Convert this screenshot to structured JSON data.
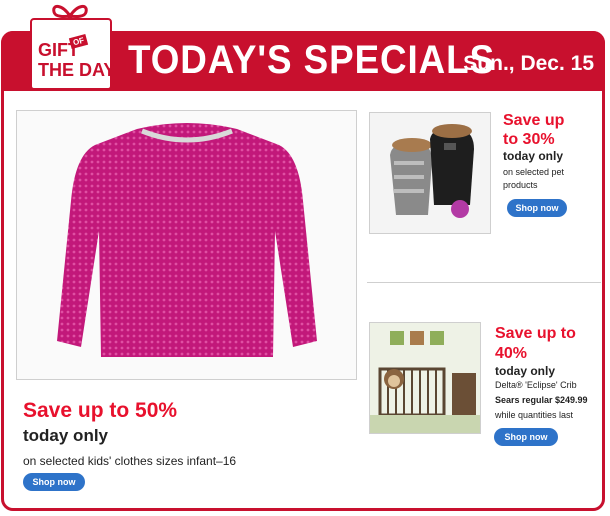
{
  "header": {
    "badge_line1": "GIFT",
    "badge_of": "OF",
    "badge_line2": "THE DAY",
    "title": "TODAY'S SPECIALS",
    "date": "Sun., Dec. 15"
  },
  "main_deal": {
    "image_alt": "pink knit sweater",
    "save_text": "Save up to 50%",
    "today_text": "today only",
    "description": "on selected kids' clothes sizes infant–16",
    "button_label": "Shop now"
  },
  "pet_deal": {
    "image_alt": "pet coats",
    "save_line1": "Save up",
    "save_line2": "to 30%",
    "today_text": "today only",
    "desc_line1": "on selected pet",
    "desc_line2": "products",
    "button_label": "Shop now"
  },
  "crib_deal": {
    "image_alt": "baby crib nursery",
    "save_line1": "Save up to",
    "save_line2": "40%",
    "today_text": "today only",
    "description": "Delta® 'Eclipse' Crib",
    "price": "Sears regular $249.99",
    "note": "while quantities last",
    "button_label": "Shop now"
  },
  "colors": {
    "brand_red": "#c8102e",
    "sale_red": "#e8112d",
    "button_blue": "#2e73c9"
  }
}
